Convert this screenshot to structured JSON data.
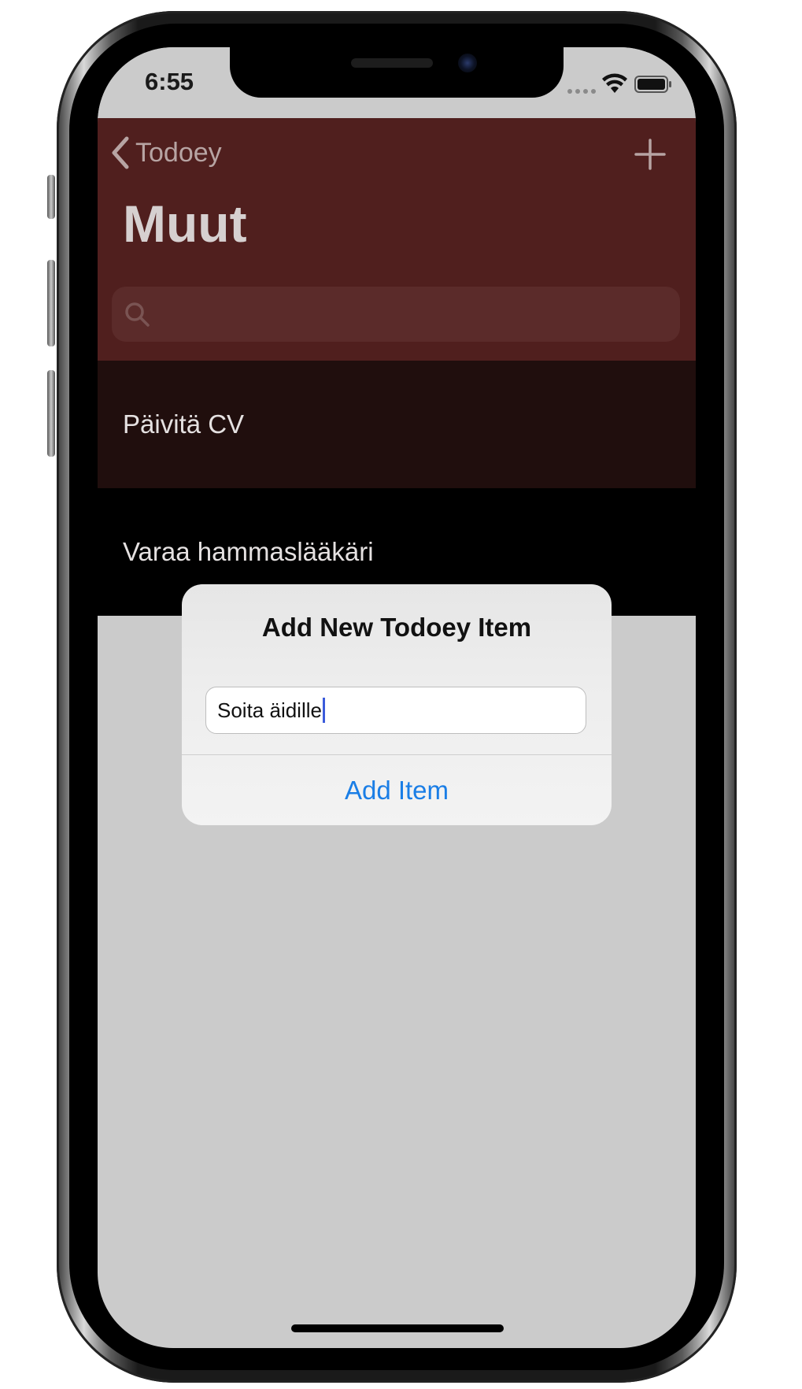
{
  "status_bar": {
    "time": "6:55",
    "wifi_icon": "wifi-icon",
    "battery_icon": "battery-icon"
  },
  "nav": {
    "back_label": "Todoey",
    "back_icon": "chevron-left-icon",
    "add_icon": "plus-icon",
    "title": "Muut",
    "bar_color": "#501f1e"
  },
  "search": {
    "icon": "search-icon",
    "placeholder": ""
  },
  "items": [
    {
      "label": "Päivitä CV",
      "color": "#200e0d"
    },
    {
      "label": "Varaa hammaslääkäri",
      "color": "#000000"
    }
  ],
  "alert": {
    "title": "Add New Todoey Item",
    "input_value": "Soita äidille",
    "action_label": "Add Item",
    "action_color": "#1a7ee6"
  }
}
